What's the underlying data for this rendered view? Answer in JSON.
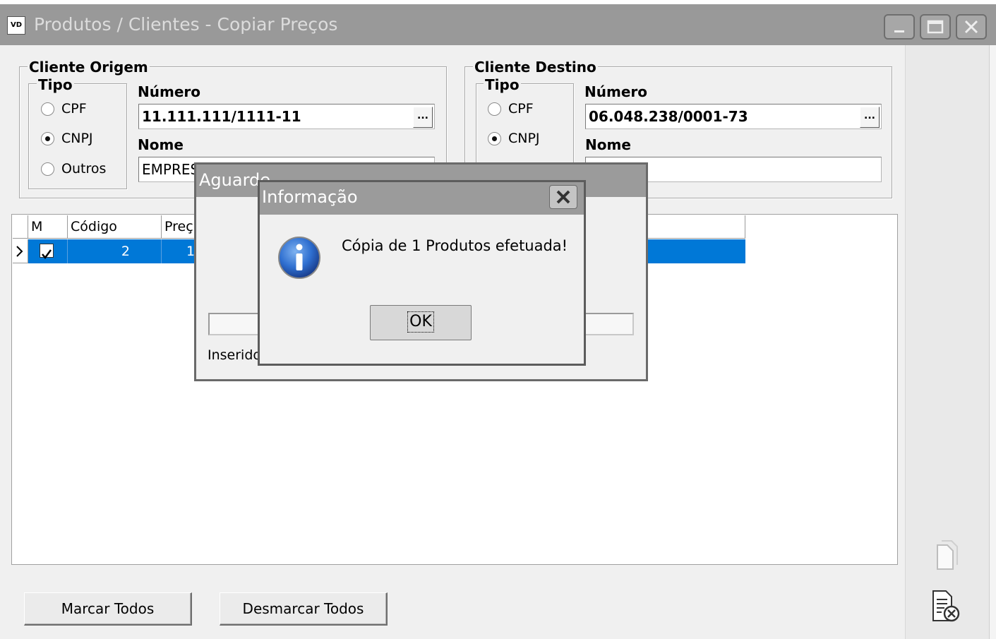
{
  "window": {
    "icon_text": "VD",
    "title": "Produtos / Clientes - Copiar Preços"
  },
  "origem": {
    "group_label": "Cliente Origem",
    "tipo_label": "Tipo",
    "options": [
      "CPF",
      "CNPJ",
      "Outros"
    ],
    "selected": "CNPJ",
    "numero_label": "Número",
    "numero_value": "11.111.111/1111-11",
    "nome_label": "Nome",
    "nome_value": "EMPRES"
  },
  "destino": {
    "group_label": "Cliente Destino",
    "tipo_label": "Tipo",
    "options": [
      "CPF",
      "CNPJ"
    ],
    "selected": "CNPJ",
    "numero_label": "Número",
    "numero_value": "06.048.238/0001-73",
    "nome_label": "Nome",
    "nome_value": ""
  },
  "ellipsis_label": "...",
  "grid": {
    "columns": [
      "M",
      "Código",
      "Preç"
    ],
    "rows": [
      {
        "marked": true,
        "codigo": "2",
        "preco": "1"
      }
    ]
  },
  "buttons": {
    "marcar_todos": "Marcar Todos",
    "desmarcar_todos": "Desmarcar Todos"
  },
  "sidebar": {
    "icons": [
      "copy-icon",
      "document-cancel-icon"
    ]
  },
  "aguarde_dialog": {
    "title": "Aguarde",
    "status_text": "Inserido"
  },
  "info_dialog": {
    "title": "Informação",
    "message": "Cópia de 1 Produtos efetuada!",
    "ok_label": "OK",
    "icon": "information-icon"
  },
  "colors": {
    "titlebar": "#999999",
    "selection": "#0078d7",
    "info_icon": "#1f5fbf"
  }
}
